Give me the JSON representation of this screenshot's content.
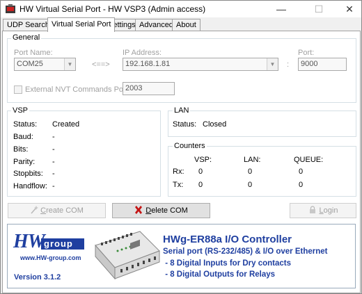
{
  "window": {
    "title": "HW Virtual Serial Port - HW VSP3 (Admin access)",
    "minimize": "—",
    "maximize": "☐",
    "close": "✕"
  },
  "tabs": [
    {
      "label": "UDP Search"
    },
    {
      "label": "Virtual Serial Port",
      "active": true
    },
    {
      "label": "Settings"
    },
    {
      "label": "Advanced"
    },
    {
      "label": "About"
    }
  ],
  "general": {
    "title": "General",
    "port_name_label": "Port Name:",
    "port_name_value": "COM25",
    "arrow": "<==>",
    "ip_label": "IP Address:",
    "ip_value": "192.168.1.81",
    "colon": ":",
    "port_label": "Port:",
    "port_value": "9000",
    "nvt_label": "External NVT Commands Port:",
    "nvt_value": "2003"
  },
  "vsp": {
    "title": "VSP",
    "rows": [
      {
        "label": "Status:",
        "value": "Created"
      },
      {
        "label": "Baud:",
        "value": "-"
      },
      {
        "label": "Bits:",
        "value": "-"
      },
      {
        "label": "Parity:",
        "value": "-"
      },
      {
        "label": "Stopbits:",
        "value": "-"
      },
      {
        "label": "Handflow:",
        "value": "-"
      }
    ]
  },
  "lan": {
    "title": "LAN",
    "status_label": "Status:",
    "status_value": "Closed"
  },
  "counters": {
    "title": "Counters",
    "headers": [
      "VSP:",
      "LAN:",
      "QUEUE:"
    ],
    "rx_label": "Rx:",
    "tx_label": "Tx:",
    "rx": [
      "0",
      "0",
      "0"
    ],
    "tx": [
      "0",
      "0",
      "0"
    ]
  },
  "buttons": {
    "create_first": "C",
    "create_rest": "reate COM",
    "delete_first": "D",
    "delete_rest": "elete COM",
    "login_first": "L",
    "login_rest": "ogin"
  },
  "banner": {
    "logo_hw": "HW",
    "logo_group": "group",
    "logo_url": "www.HW-group.com",
    "version": "Version  3.1.2",
    "product_title": "HWg-ER88a  I/O Controller",
    "line1": "Serial port (RS-232/485) & I/O over Ethernet",
    "line2": " - 8 Digital Inputs for Dry contacts",
    "line3": " - 8 Digital Outputs for Relays",
    "brand_color": "#1f3fa0",
    "accent_red": "#d01010"
  }
}
